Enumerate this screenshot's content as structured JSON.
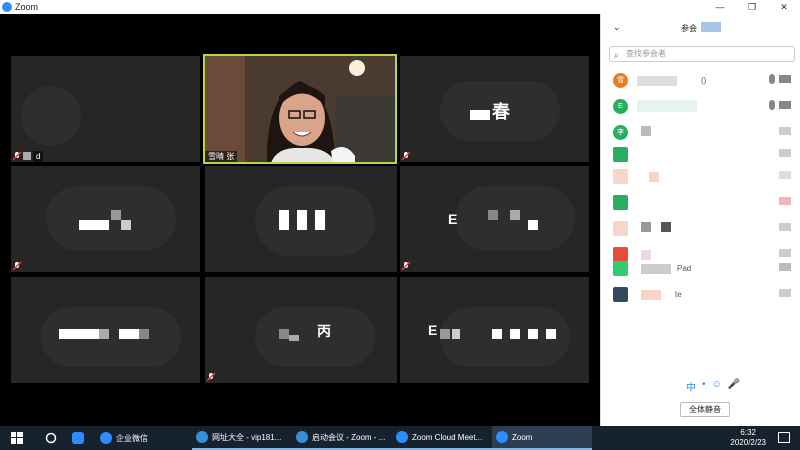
{
  "window": {
    "title": "Zoom",
    "controls": [
      "—",
      "❐",
      "✕"
    ]
  },
  "tiles": [
    {
      "name": "",
      "label": "d",
      "muted": true
    },
    {
      "name": "",
      "label": "雪晴 张",
      "muted": false,
      "active": true
    },
    {
      "name": "春",
      "label": "",
      "muted": true
    },
    {
      "name": "",
      "label": "",
      "muted": true
    },
    {
      "name": "",
      "label": "",
      "muted": false
    },
    {
      "name": "E",
      "label": "",
      "muted": true
    },
    {
      "name": "",
      "label": "",
      "muted": false
    },
    {
      "name": "丙",
      "label": "",
      "muted": true
    },
    {
      "name": "E",
      "label": "",
      "muted": false
    }
  ],
  "panel": {
    "title": "参会",
    "search_placeholder": "查找参会者",
    "participants": [
      {
        "avatar": "雪",
        "color": "#e67e22",
        "suffix": "()"
      },
      {
        "avatar": "E",
        "color": "#27ae60",
        "suffix": ""
      },
      {
        "avatar": "李",
        "color": "#27ae60",
        "suffix": ""
      },
      {
        "avatar": "",
        "color": "#27ae60",
        "suffix": ""
      },
      {
        "avatar": "",
        "color": "#f5d6c8",
        "suffix": ""
      },
      {
        "avatar": "",
        "color": "#27ae60",
        "suffix": ""
      },
      {
        "avatar": "",
        "color": "#f5d6c8",
        "suffix": ""
      },
      {
        "avatar": "",
        "color": "#e74c3c",
        "suffix": ""
      },
      {
        "avatar": "",
        "color": "#2ecc71",
        "suffix": "Pad"
      },
      {
        "avatar": "",
        "color": "#34495e",
        "suffix": "te"
      }
    ],
    "ime_items": [
      "中",
      "•",
      "☺",
      "🎤"
    ],
    "mute_all_label": "全体静音"
  },
  "taskbar": {
    "items": [
      {
        "label": "企业微信",
        "color": "#2d8cff"
      },
      {
        "label": "网址大全 - vip181...",
        "color": "#3b8ed8"
      },
      {
        "label": "启动会议 - Zoom - ...",
        "color": "#3b8ed8"
      },
      {
        "label": "Zoom Cloud Meet...",
        "color": "#2d8cff"
      },
      {
        "label": "Zoom",
        "color": "#2d8cff"
      }
    ],
    "time": "6:32",
    "date": "2020/2/23"
  }
}
